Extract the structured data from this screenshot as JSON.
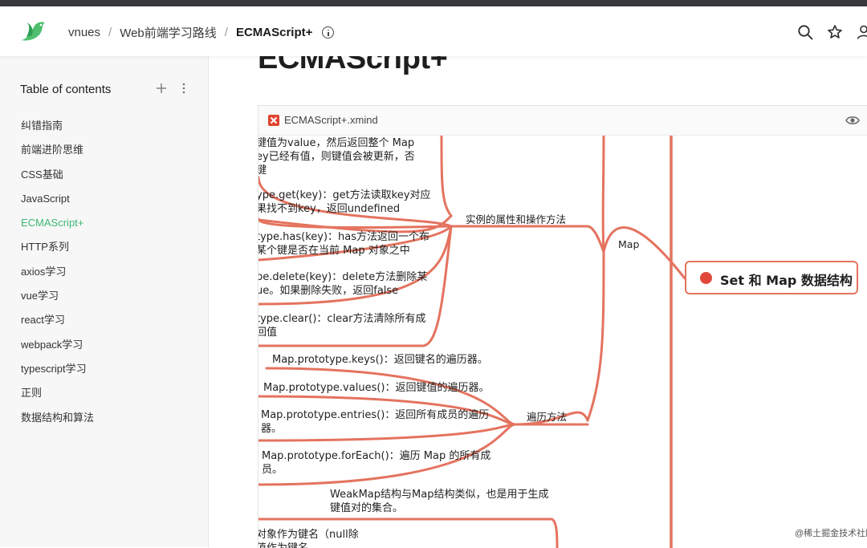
{
  "header": {
    "breadcrumb": [
      "vnues",
      "Web前端学习路线",
      "ECMAScript+"
    ],
    "separator": "/",
    "brand_color": "#4fbf6f"
  },
  "sidebar": {
    "title": "Table of contents",
    "active_color": "#3db874",
    "items": [
      {
        "label": "纠错指南",
        "active": false
      },
      {
        "label": "前端进阶思维",
        "active": false
      },
      {
        "label": "CSS基础",
        "active": false
      },
      {
        "label": "JavaScript",
        "active": false
      },
      {
        "label": "ECMAScript+",
        "active": true
      },
      {
        "label": "HTTP系列",
        "active": false
      },
      {
        "label": "axios学习",
        "active": false
      },
      {
        "label": "vue学习",
        "active": false
      },
      {
        "label": "react学习",
        "active": false
      },
      {
        "label": "webpack学习",
        "active": false
      },
      {
        "label": "typescript学习",
        "active": false
      },
      {
        "label": "正则",
        "active": false
      },
      {
        "label": "数据结构和算法",
        "active": false
      }
    ]
  },
  "main": {
    "title": "ECMAScript+",
    "embed": {
      "file_name": "ECMAScript+.xmind",
      "file_icon": "xmind-icon",
      "action_icon": "eye-icon"
    },
    "mindmap": {
      "branch_color": "#e4735f",
      "central": "Set 和 Map 数据结构",
      "branch_map": "Map",
      "sub_instance": "实例的属性和操作方法",
      "sub_traverse": "遍历方法",
      "nodes": {
        "set_line1": "键值为value，然后返回整个 Map",
        "set_line2": "ey已经有值，则键值会被更新，否",
        "set_line3": "键",
        "get_line1": "ype.get(key)：get方法读取key对应",
        "get_line2": "果找不到key，返回undefined",
        "has_line1": "type.has(key)：has方法返回一个布",
        "has_line2": "某个键是否在当前 Map 对象之中",
        "delete_line1": "pe.delete(key)：delete方法删除某",
        "delete_line2": "ue。如果删除失败，返回false",
        "clear_line1": "type.clear()：clear方法清除所有成",
        "clear_line2": "回值",
        "keys": "Map.prototype.keys()：返回键名的遍历器。",
        "values": "Map.prototype.values()：返回键值的遍历器。",
        "entries_line1": "Map.prototype.entries()：返回所有成员的遍历",
        "entries_line2": "器。",
        "foreach_line1": "Map.prototype.forEach()：遍历 Map 的所有成",
        "foreach_line2": "员。",
        "weakmap_line1": "WeakMap结构与Map结构类似，也是用于生成",
        "weakmap_line2": "键值对的集合。",
        "weak_key_line1": "对象作为键名（null除",
        "weak_key_line2": "值作为键名。"
      }
    }
  },
  "watermark": "@稀土掘金技术社区"
}
